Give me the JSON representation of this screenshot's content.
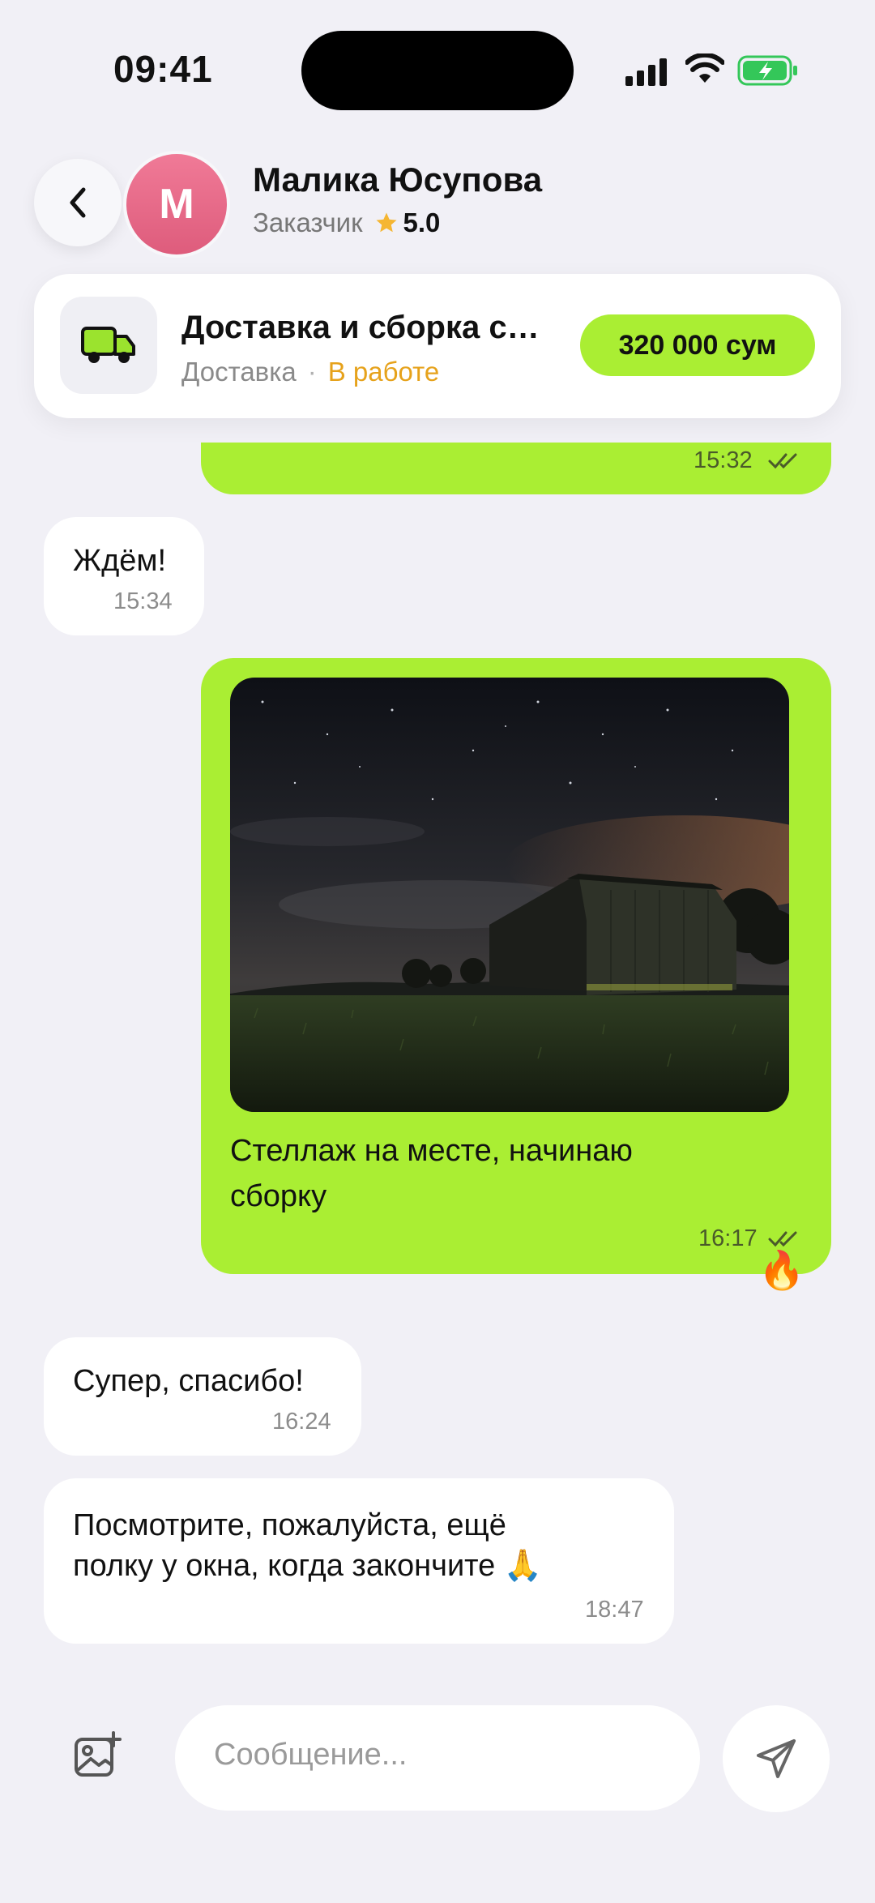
{
  "status_bar": {
    "time": "09:41"
  },
  "header": {
    "avatar_letter": "М",
    "name": "Малика Юсупова",
    "role": "Заказчик",
    "rating": "5.0"
  },
  "order": {
    "title": "Доставка и сборка стеллажа",
    "category": "Доставка",
    "separator": "·",
    "status": "В работе",
    "price": "320 000 сум"
  },
  "messages": [
    {
      "direction": "out",
      "time": "15:32",
      "read": true
    },
    {
      "direction": "in",
      "text": "Ждём!",
      "time": "15:34"
    },
    {
      "direction": "out",
      "type": "photo",
      "caption_line1": "Стеллаж на месте, начинаю",
      "caption_line2": "сборку",
      "time": "16:17",
      "read": true,
      "reaction": "🔥"
    },
    {
      "direction": "in",
      "text": "Супер, спасибо!",
      "time": "16:24"
    },
    {
      "direction": "in",
      "line1": "Посмотрите, пожалуйста, ещё",
      "line2": "полку у окна, когда закончите 🙏",
      "time": "18:47"
    }
  ],
  "composer": {
    "placeholder": "Сообщение..."
  },
  "colors": {
    "accent": "#AAEE33",
    "status": "#E6A21B",
    "background": "#F1F0F6"
  },
  "icons": [
    "back-chevron-icon",
    "star-icon",
    "truck-icon",
    "double-check-icon",
    "attach-image-icon",
    "send-icon"
  ]
}
